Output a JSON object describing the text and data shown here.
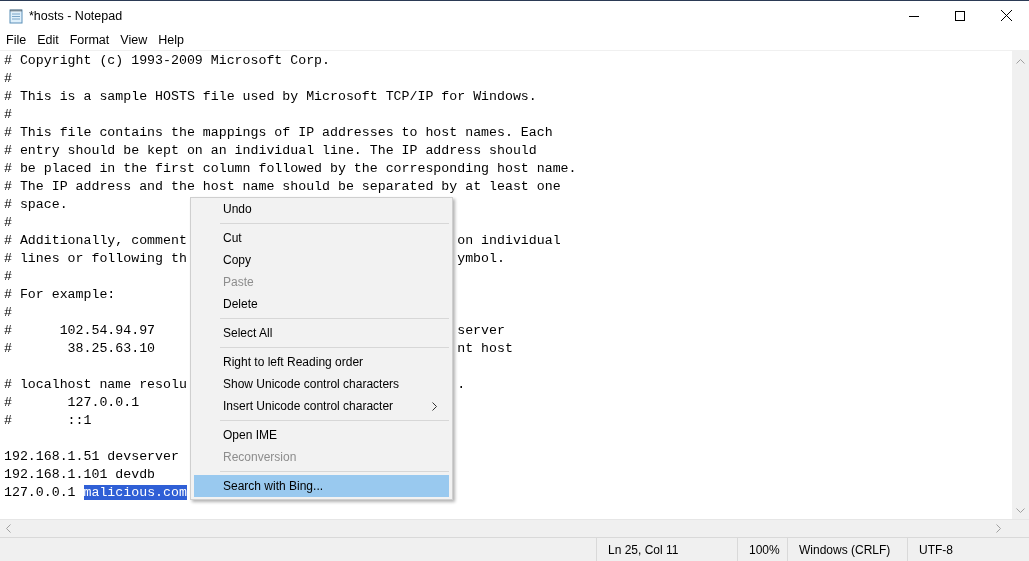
{
  "window": {
    "title": "*hosts - Notepad"
  },
  "menu_bar": [
    "File",
    "Edit",
    "Format",
    "View",
    "Help"
  ],
  "editor": {
    "blocks": [
      [
        {
          "text": "# Copyright (c) 1993-2009 Microsoft Corp."
        },
        {
          "text": "#"
        },
        {
          "text": "# This is a sample HOSTS file used by Microsoft TCP/IP for Windows."
        },
        {
          "text": "#"
        },
        {
          "text": "# This file contains the mappings of IP addresses to host names. Each"
        },
        {
          "text": "# entry should be kept on an individual line. The IP address should"
        },
        {
          "text": "# be placed in the first column followed by the corresponding host name."
        },
        {
          "text": "# The IP address and the host name should be separated by at least one"
        },
        {
          "text": "# space."
        },
        {
          "text": "#"
        },
        {
          "text": "# Additionally, comment",
          "right_text": "on individual"
        },
        {
          "text": "# lines or following th",
          "right_text": "ymbol."
        },
        {
          "text": "#"
        },
        {
          "text": "# For example:"
        },
        {
          "text": "#"
        },
        {
          "text": "#      102.54.94.97",
          "right_text": "server"
        },
        {
          "text": "#       38.25.63.10",
          "right_text": "nt host"
        }
      ],
      [
        {
          "text": "# localhost name resolu",
          "right_text": "."
        },
        {
          "text": "#       127.0.0.1"
        },
        {
          "text": "#       ::1"
        }
      ],
      [
        {
          "text": "192.168.1.51 devserver"
        },
        {
          "text": "192.168.1.101 devdb"
        },
        {
          "text": "127.0.0.1 ",
          "selected_text": "malicious.com"
        }
      ]
    ]
  },
  "context_menu": [
    {
      "kind": "item",
      "label": "Undo",
      "disabled": false,
      "selected": false
    },
    {
      "kind": "separator"
    },
    {
      "kind": "item",
      "label": "Cut",
      "disabled": false,
      "selected": false
    },
    {
      "kind": "item",
      "label": "Copy",
      "disabled": false,
      "selected": false
    },
    {
      "kind": "item",
      "label": "Paste",
      "disabled": true,
      "selected": false
    },
    {
      "kind": "item",
      "label": "Delete",
      "disabled": false,
      "selected": false
    },
    {
      "kind": "separator"
    },
    {
      "kind": "item",
      "label": "Select All",
      "disabled": false,
      "selected": false
    },
    {
      "kind": "separator"
    },
    {
      "kind": "item",
      "label": "Right to left Reading order",
      "disabled": false,
      "selected": false
    },
    {
      "kind": "item",
      "label": "Show Unicode control characters",
      "disabled": false,
      "selected": false
    },
    {
      "kind": "submenu",
      "label": "Insert Unicode control character",
      "disabled": false,
      "selected": false
    },
    {
      "kind": "separator"
    },
    {
      "kind": "item",
      "label": "Open IME",
      "disabled": false,
      "selected": false
    },
    {
      "kind": "item",
      "label": "Reconversion",
      "disabled": true,
      "selected": false
    },
    {
      "kind": "separator"
    },
    {
      "kind": "item",
      "label": "Search with Bing...",
      "disabled": false,
      "selected": true
    }
  ],
  "status_bar": [
    "Ln 25, Col 11",
    "100%",
    "Windows (CRLF)",
    "UTF-8"
  ]
}
